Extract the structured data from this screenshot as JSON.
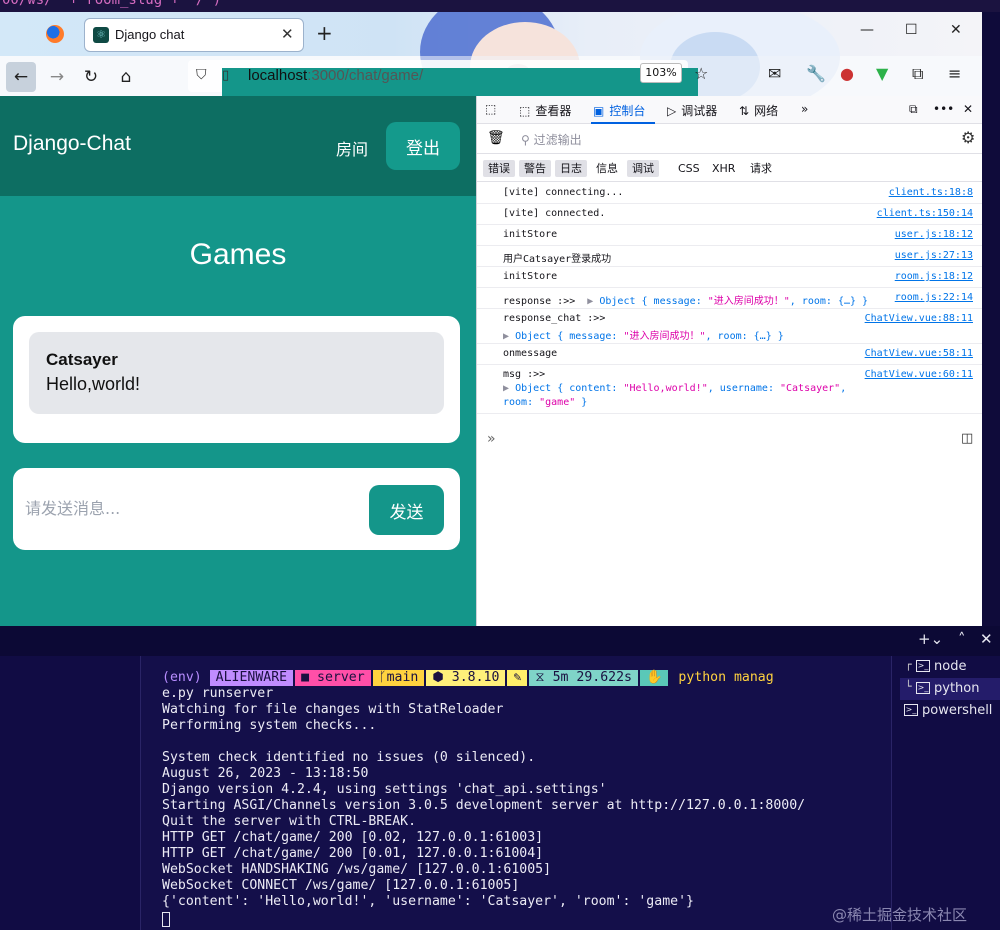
{
  "code_strip": "00/ws/' + room_slug + '/')",
  "browser": {
    "tab_title": "Django chat",
    "url_host": "localhost",
    "url_path": ":3000/chat/game/",
    "zoom": "103%"
  },
  "page": {
    "brand": "Django-Chat",
    "nav_room": "房间",
    "logout": "登出",
    "games_title": "Games",
    "message": {
      "username": "Catsayer",
      "text": "Hello,world!"
    },
    "input_placeholder": "请发送消息...",
    "send_label": "发送"
  },
  "devtools": {
    "tabs": [
      "查看器",
      "控制台",
      "调试器",
      "网络"
    ],
    "filter_placeholder": "过滤输出",
    "levels": [
      "错误",
      "警告",
      "日志",
      "信息",
      "调试",
      "CSS",
      "XHR",
      "请求"
    ],
    "rows": [
      {
        "msg": "[vite] connecting...",
        "src": "client.ts:18:8"
      },
      {
        "msg": "[vite] connected.",
        "src": "client.ts:150:14"
      },
      {
        "msg": "initStore",
        "src": "user.js:18:12"
      },
      {
        "msg": "用户Catsayer登录成功",
        "src": "user.js:27:13"
      },
      {
        "msg": "initStore",
        "src": "room.js:18:12"
      },
      {
        "msg": "response :>>",
        "obj": "Object { message: ",
        "str": "\"进入房间成功！\"",
        "rest": ", room: {…} }",
        "src": "room.js:22:14"
      },
      {
        "msg": "response_chat :>>",
        "obj": "Object { message: ",
        "str": "\"进入房间成功！\"",
        "rest": ", room: {…} }",
        "src": "ChatView.vue:88:11"
      },
      {
        "msg": "onmessage",
        "src": "ChatView.vue:58:11"
      },
      {
        "msg": "msg :>>",
        "obj": "Object { content: ",
        "str": "\"Hello,world!\"",
        "rest": ", username: ",
        "str2": "\"Catsayer\"",
        "rest2": ",",
        "line2a": "room: ",
        "line2b": "\"game\"",
        "line2c": " }",
        "src": "ChatView.vue:60:11"
      }
    ]
  },
  "terminal": {
    "env": "(env)",
    "host": "ALIENWARE",
    "dir": "server",
    "branch": "main",
    "py": "3.8.10",
    "time": "5m 29.622s",
    "cmd": "python manag",
    "lines": [
      "e.py runserver",
      "Watching for file changes with StatReloader",
      "Performing system checks...",
      "",
      "System check identified no issues (0 silenced).",
      "August 26, 2023 - 13:18:50",
      "Django version 4.2.4, using settings 'chat_api.settings'",
      "Starting ASGI/Channels version 3.0.5 development server at http://127.0.0.1:8000/",
      "Quit the server with CTRL-BREAK.",
      "HTTP GET /chat/game/ 200 [0.02, 127.0.0.1:61003]",
      "HTTP GET /chat/game/ 200 [0.01, 127.0.0.1:61004]",
      "WebSocket HANDSHAKING /ws/game/ [127.0.0.1:61005]",
      "WebSocket CONNECT /ws/game/ [127.0.0.1:61005]",
      "{'content': 'Hello,world!', 'username': 'Catsayer', 'room': 'game'}"
    ],
    "shells": [
      "node",
      "python",
      "powershell"
    ],
    "watermark": "@稀土掘金技术社区"
  }
}
